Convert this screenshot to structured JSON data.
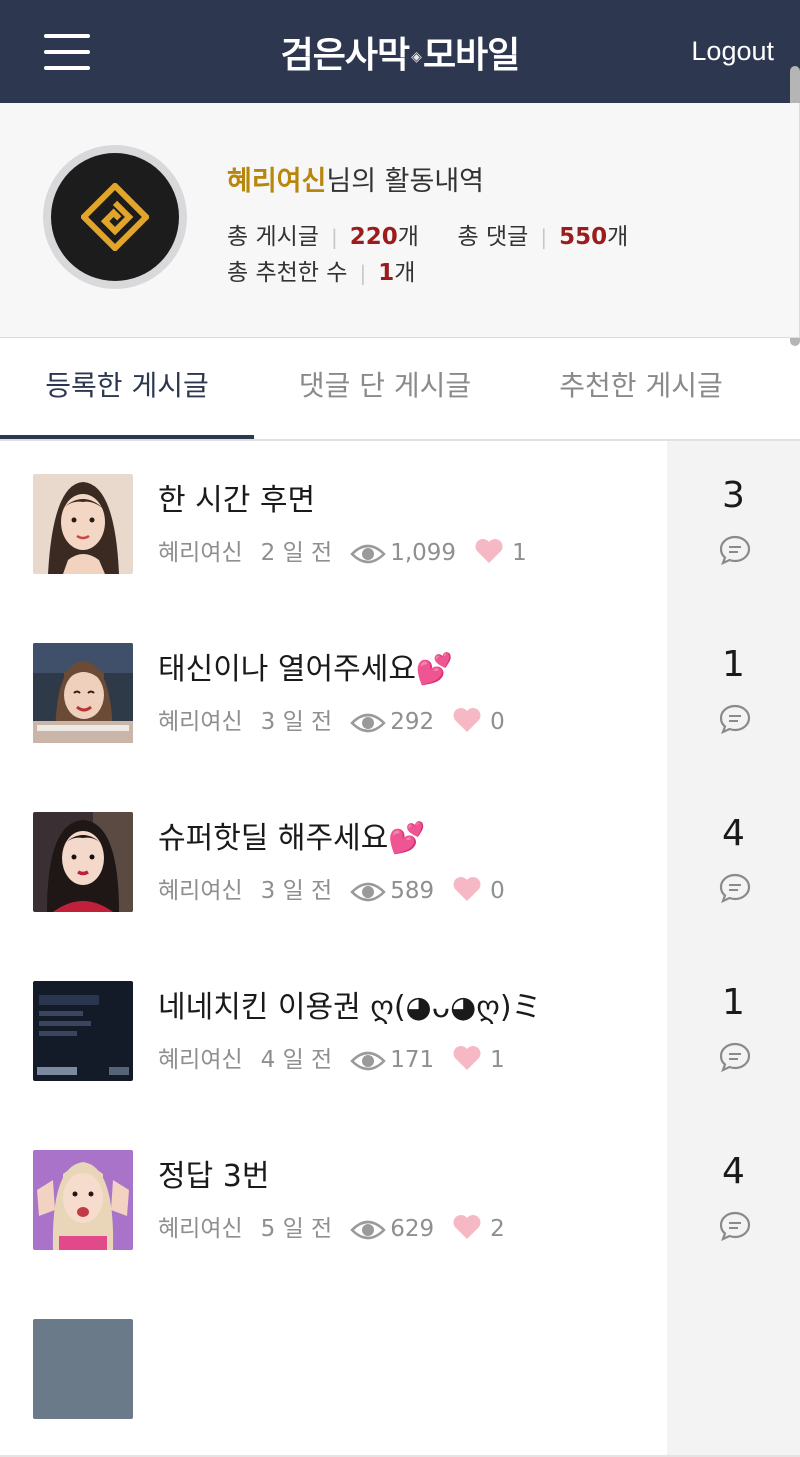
{
  "header": {
    "brand_part1": "검은사막",
    "brand_part2": "모바일",
    "brand_diamond": "◈",
    "logout_label": "Logout",
    "background_color": "#2e3750"
  },
  "profile": {
    "nickname": "혜리여신",
    "title_suffix": "님의 활동내역",
    "stats": {
      "posts_label": "총 게시글",
      "posts_value": "220",
      "posts_unit": "개",
      "comments_label": "총 댓글",
      "comments_value": "550",
      "comments_unit": "개",
      "likes_label": "총 추천한 수",
      "likes_value": "1",
      "likes_unit": "개"
    },
    "accent_color": "#b8860b",
    "number_color": "#9b1c1c"
  },
  "tabs": [
    {
      "label": "등록한 게시글",
      "active": true
    },
    {
      "label": "댓글 단 게시글",
      "active": false
    },
    {
      "label": "추천한 게시글",
      "active": false
    }
  ],
  "posts": [
    {
      "title": "한 시간 후면",
      "author": "혜리여신",
      "time": "2 일 전",
      "views": "1,099",
      "likes": "1",
      "comments": "3",
      "thumb": "portrait-woman"
    },
    {
      "title": "태신이나 열어주세요💕",
      "author": "혜리여신",
      "time": "3 일 전",
      "views": "292",
      "likes": "0",
      "comments": "1",
      "thumb": "tv-screenshot"
    },
    {
      "title": "슈퍼핫딜 해주세요💕",
      "author": "혜리여신",
      "time": "3 일 전",
      "views": "589",
      "likes": "0",
      "comments": "4",
      "thumb": "portrait-woman-red"
    },
    {
      "title": "네네치킨 이용권 ღ(◕ᴗ◕ღ)ミ",
      "author": "혜리여신",
      "time": "4 일 전",
      "views": "171",
      "likes": "1",
      "comments": "1",
      "thumb": "game-screenshot"
    },
    {
      "title": "정답 3번",
      "author": "혜리여신",
      "time": "5 일 전",
      "views": "629",
      "likes": "2",
      "comments": "4",
      "thumb": "portrait-purple"
    }
  ],
  "icons": {
    "views": "eye-icon",
    "likes": "heart-icon",
    "comments": "comment-bubble-icon",
    "menu": "hamburger-menu-icon"
  }
}
